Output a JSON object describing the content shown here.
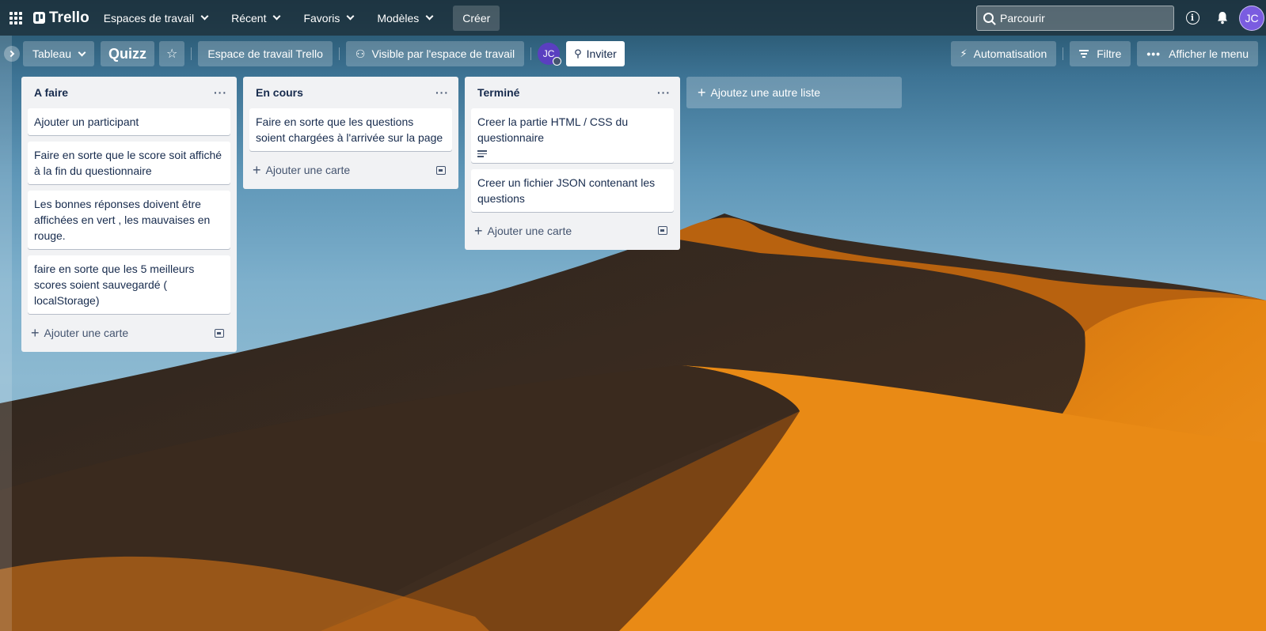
{
  "header": {
    "logo_text": "Trello",
    "nav": [
      "Espaces de travail",
      "Récent",
      "Favoris",
      "Modèles"
    ],
    "create_label": "Créer",
    "search_placeholder": "Parcourir",
    "avatar_initials": "JC"
  },
  "board": {
    "view_label": "Tableau",
    "title": "Quizz",
    "workspace_label": "Espace de travail Trello",
    "visibility_label": "Visible par l'espace de travail",
    "member_initials": "JC",
    "invite_label": "Inviter",
    "automation_label": "Automatisation",
    "filter_label": "Filtre",
    "menu_label": "Afficher le menu"
  },
  "lists": [
    {
      "title": "A faire",
      "cards": [
        "Ajouter un participant",
        "Faire en sorte que le score soit affiché à la fin du questionnaire",
        "Les bonnes réponses doivent être affichées en vert , les mauvaises en rouge.",
        "faire en sorte que les 5 meilleurs scores soient sauvegardé ( localStorage)"
      ],
      "add_card_label": "Ajouter une carte"
    },
    {
      "title": "En cours",
      "cards": [
        "Faire en sorte que les questions soient chargées à l'arrivée sur la page"
      ],
      "add_card_label": "Ajouter une carte"
    },
    {
      "title": "Terminé",
      "cards": [
        "Creer la partie HTML / CSS du questionnaire",
        "Creer un fichier JSON contenant les questions"
      ],
      "add_card_label": "Ajouter une carte"
    }
  ],
  "add_list_label": "Ajoutez une autre liste",
  "icons": {
    "apps": "apps-grid-icon",
    "star": "star-icon",
    "visibility": "people-icon",
    "invite": "person-add-icon",
    "automation": "bolt-icon",
    "filter": "filter-icon",
    "menu": "more-dots-icon",
    "info": "info-icon",
    "bell": "bell-icon",
    "search": "search-icon"
  }
}
